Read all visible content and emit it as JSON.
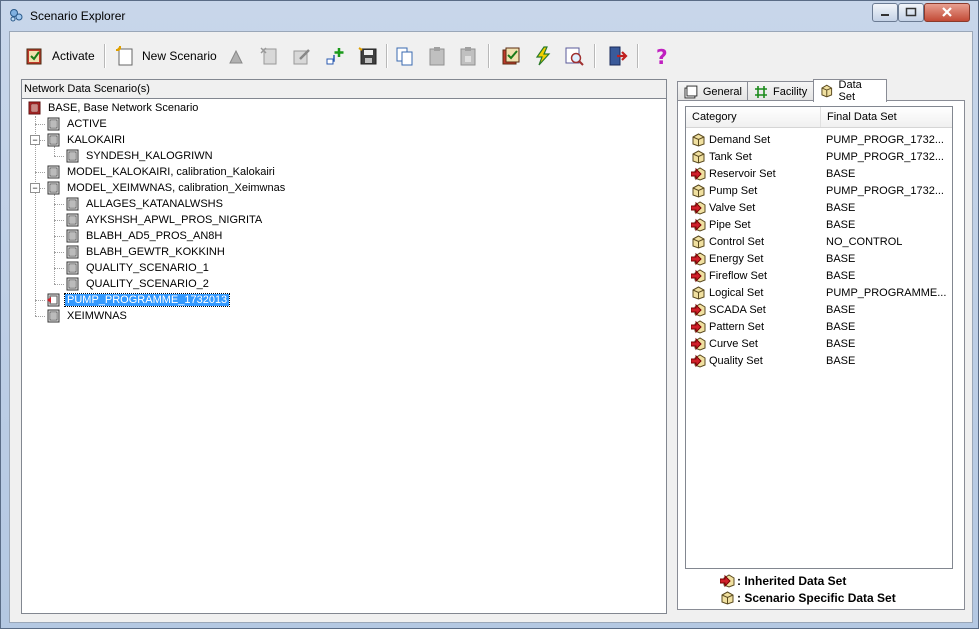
{
  "window": {
    "title": "Scenario Explorer"
  },
  "toolbar": {
    "activate_label": "Activate",
    "new_scenario_label": "New Scenario"
  },
  "left_panel": {
    "header": "Network Data Scenario(s)",
    "tree": [
      {
        "label": "BASE, Base Network Scenario",
        "icon": "root-scenario-icon"
      },
      {
        "label": "ACTIVE",
        "icon": "scenario-icon"
      },
      {
        "label": "KALOKAIRI",
        "icon": "scenario-icon",
        "expanded": true
      },
      {
        "label": "SYNDESH_KALOGRIWN",
        "icon": "scenario-icon"
      },
      {
        "label": "MODEL_KALOKAIRI, calibration_Kalokairi",
        "icon": "scenario-icon"
      },
      {
        "label": "MODEL_XEIMWNAS, calibration_Xeimwnas",
        "icon": "scenario-icon",
        "expanded": true
      },
      {
        "label": "ALLAGES_KATANALWSHS",
        "icon": "scenario-icon"
      },
      {
        "label": "AYKSHSH_APWL_PROS_NIGRITA",
        "icon": "scenario-icon"
      },
      {
        "label": "BLABH_AD5_PROS_AN8H",
        "icon": "scenario-icon"
      },
      {
        "label": "BLABH_GEWTR_KOKKINH",
        "icon": "scenario-icon"
      },
      {
        "label": "QUALITY_SCENARIO_1",
        "icon": "scenario-icon"
      },
      {
        "label": "QUALITY_SCENARIO_2",
        "icon": "scenario-icon"
      },
      {
        "label": "PUMP_PROGRAMME_1732013",
        "icon": "active-scenario-icon",
        "selected": true
      },
      {
        "label": "XEIMWNAS",
        "icon": "scenario-icon"
      }
    ]
  },
  "tabs": [
    {
      "label": "General",
      "icon": "general-icon"
    },
    {
      "label": "Facility",
      "icon": "facility-icon"
    },
    {
      "label": "Data Set",
      "icon": "dataset-icon",
      "active": true
    }
  ],
  "dataset_list": {
    "columns": [
      "Category",
      "Final Data Set"
    ],
    "rows": [
      {
        "category": "Demand Set",
        "final": "PUMP_PROGR_1732...",
        "type": "specific"
      },
      {
        "category": "Tank Set",
        "final": "PUMP_PROGR_1732...",
        "type": "specific"
      },
      {
        "category": "Reservoir Set",
        "final": "BASE",
        "type": "inherited"
      },
      {
        "category": "Pump Set",
        "final": "PUMP_PROGR_1732...",
        "type": "specific"
      },
      {
        "category": "Valve Set",
        "final": "BASE",
        "type": "inherited"
      },
      {
        "category": "Pipe Set",
        "final": "BASE",
        "type": "inherited"
      },
      {
        "category": "Control Set",
        "final": "NO_CONTROL",
        "type": "specific"
      },
      {
        "category": "Energy Set",
        "final": "BASE",
        "type": "inherited"
      },
      {
        "category": "Fireflow Set",
        "final": "BASE",
        "type": "inherited"
      },
      {
        "category": "Logical Set",
        "final": "PUMP_PROGRAMME...",
        "type": "specific"
      },
      {
        "category": "SCADA Set",
        "final": "BASE",
        "type": "inherited"
      },
      {
        "category": "Pattern Set",
        "final": "BASE",
        "type": "inherited"
      },
      {
        "category": "Curve Set",
        "final": "BASE",
        "type": "inherited"
      },
      {
        "category": "Quality Set",
        "final": "BASE",
        "type": "inherited"
      }
    ]
  },
  "legend": {
    "inherited": ": Inherited Data Set",
    "specific": ": Scenario Specific Data Set"
  },
  "colors": {
    "selection": "#3399ff",
    "inherited_arrow": "#d0202a",
    "specific_box": "#e8d070"
  }
}
